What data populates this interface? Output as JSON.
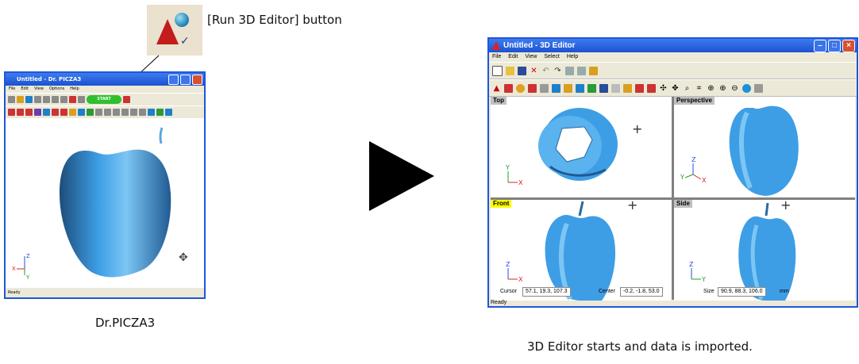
{
  "callout": {
    "label": "[Run 3D Editor] button",
    "icon": "run-3d-editor-icon"
  },
  "drpicza": {
    "window_title": "Untitled - Dr. PICZA3",
    "menu": [
      "File",
      "Edit",
      "View",
      "Options",
      "Help"
    ],
    "start_label": "START",
    "status": "Ready",
    "caption": "Dr.PICZA3"
  },
  "editor": {
    "window_title": "Untitled - 3D Editor",
    "menu": [
      "File",
      "Edit",
      "View",
      "Select",
      "Help"
    ],
    "views": {
      "top": "Top",
      "perspective": "Perspective",
      "front": "Front",
      "side": "Side"
    },
    "status": {
      "cursor_label": "Cursor",
      "cursor_value": "57.1, 19.3, 107.3",
      "center_label": "Center",
      "center_value": "-0.2, -1.8, 53.0",
      "size_label": "Size",
      "size_value": "90.9, 88.3, 106.0",
      "unit": "mm",
      "ready": "Ready"
    },
    "caption": "3D Editor starts and data is imported."
  },
  "colors": {
    "model": "#3d9ee6",
    "titlebar": "#1f57d6",
    "axis_x": "#e02020",
    "axis_y": "#20a020",
    "axis_z": "#2050e0"
  }
}
